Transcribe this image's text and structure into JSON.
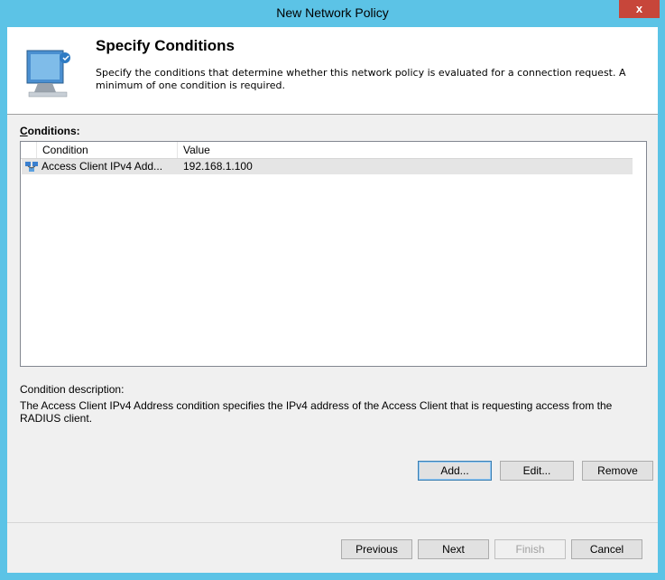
{
  "window": {
    "title": "New Network Policy",
    "close_label": "x"
  },
  "header": {
    "title": "Specify Conditions",
    "description": "Specify the conditions that determine whether this network policy is evaluated for a connection request. A minimum of one condition is required."
  },
  "conditions": {
    "label_accel": "C",
    "label_rest": "onditions:",
    "columns": [
      "Condition",
      "Value"
    ],
    "rows": [
      {
        "condition": "Access Client IPv4 Add...",
        "value": "192.168.1.100",
        "icon": "network-condition-icon"
      }
    ]
  },
  "description": {
    "label": "Condition description:",
    "text": "The Access Client IPv4 Address condition specifies the IPv4 address of the Access Client that is requesting access from the RADIUS client."
  },
  "actions": {
    "add": "Add...",
    "edit": "Edit...",
    "remove": "Remove"
  },
  "footer": {
    "previous": "Previous",
    "next": "Next",
    "finish": "Finish",
    "cancel": "Cancel"
  },
  "colors": {
    "titlebar": "#5cc3e6",
    "close": "#c7463a",
    "selected_row": "#e5e5e5"
  }
}
